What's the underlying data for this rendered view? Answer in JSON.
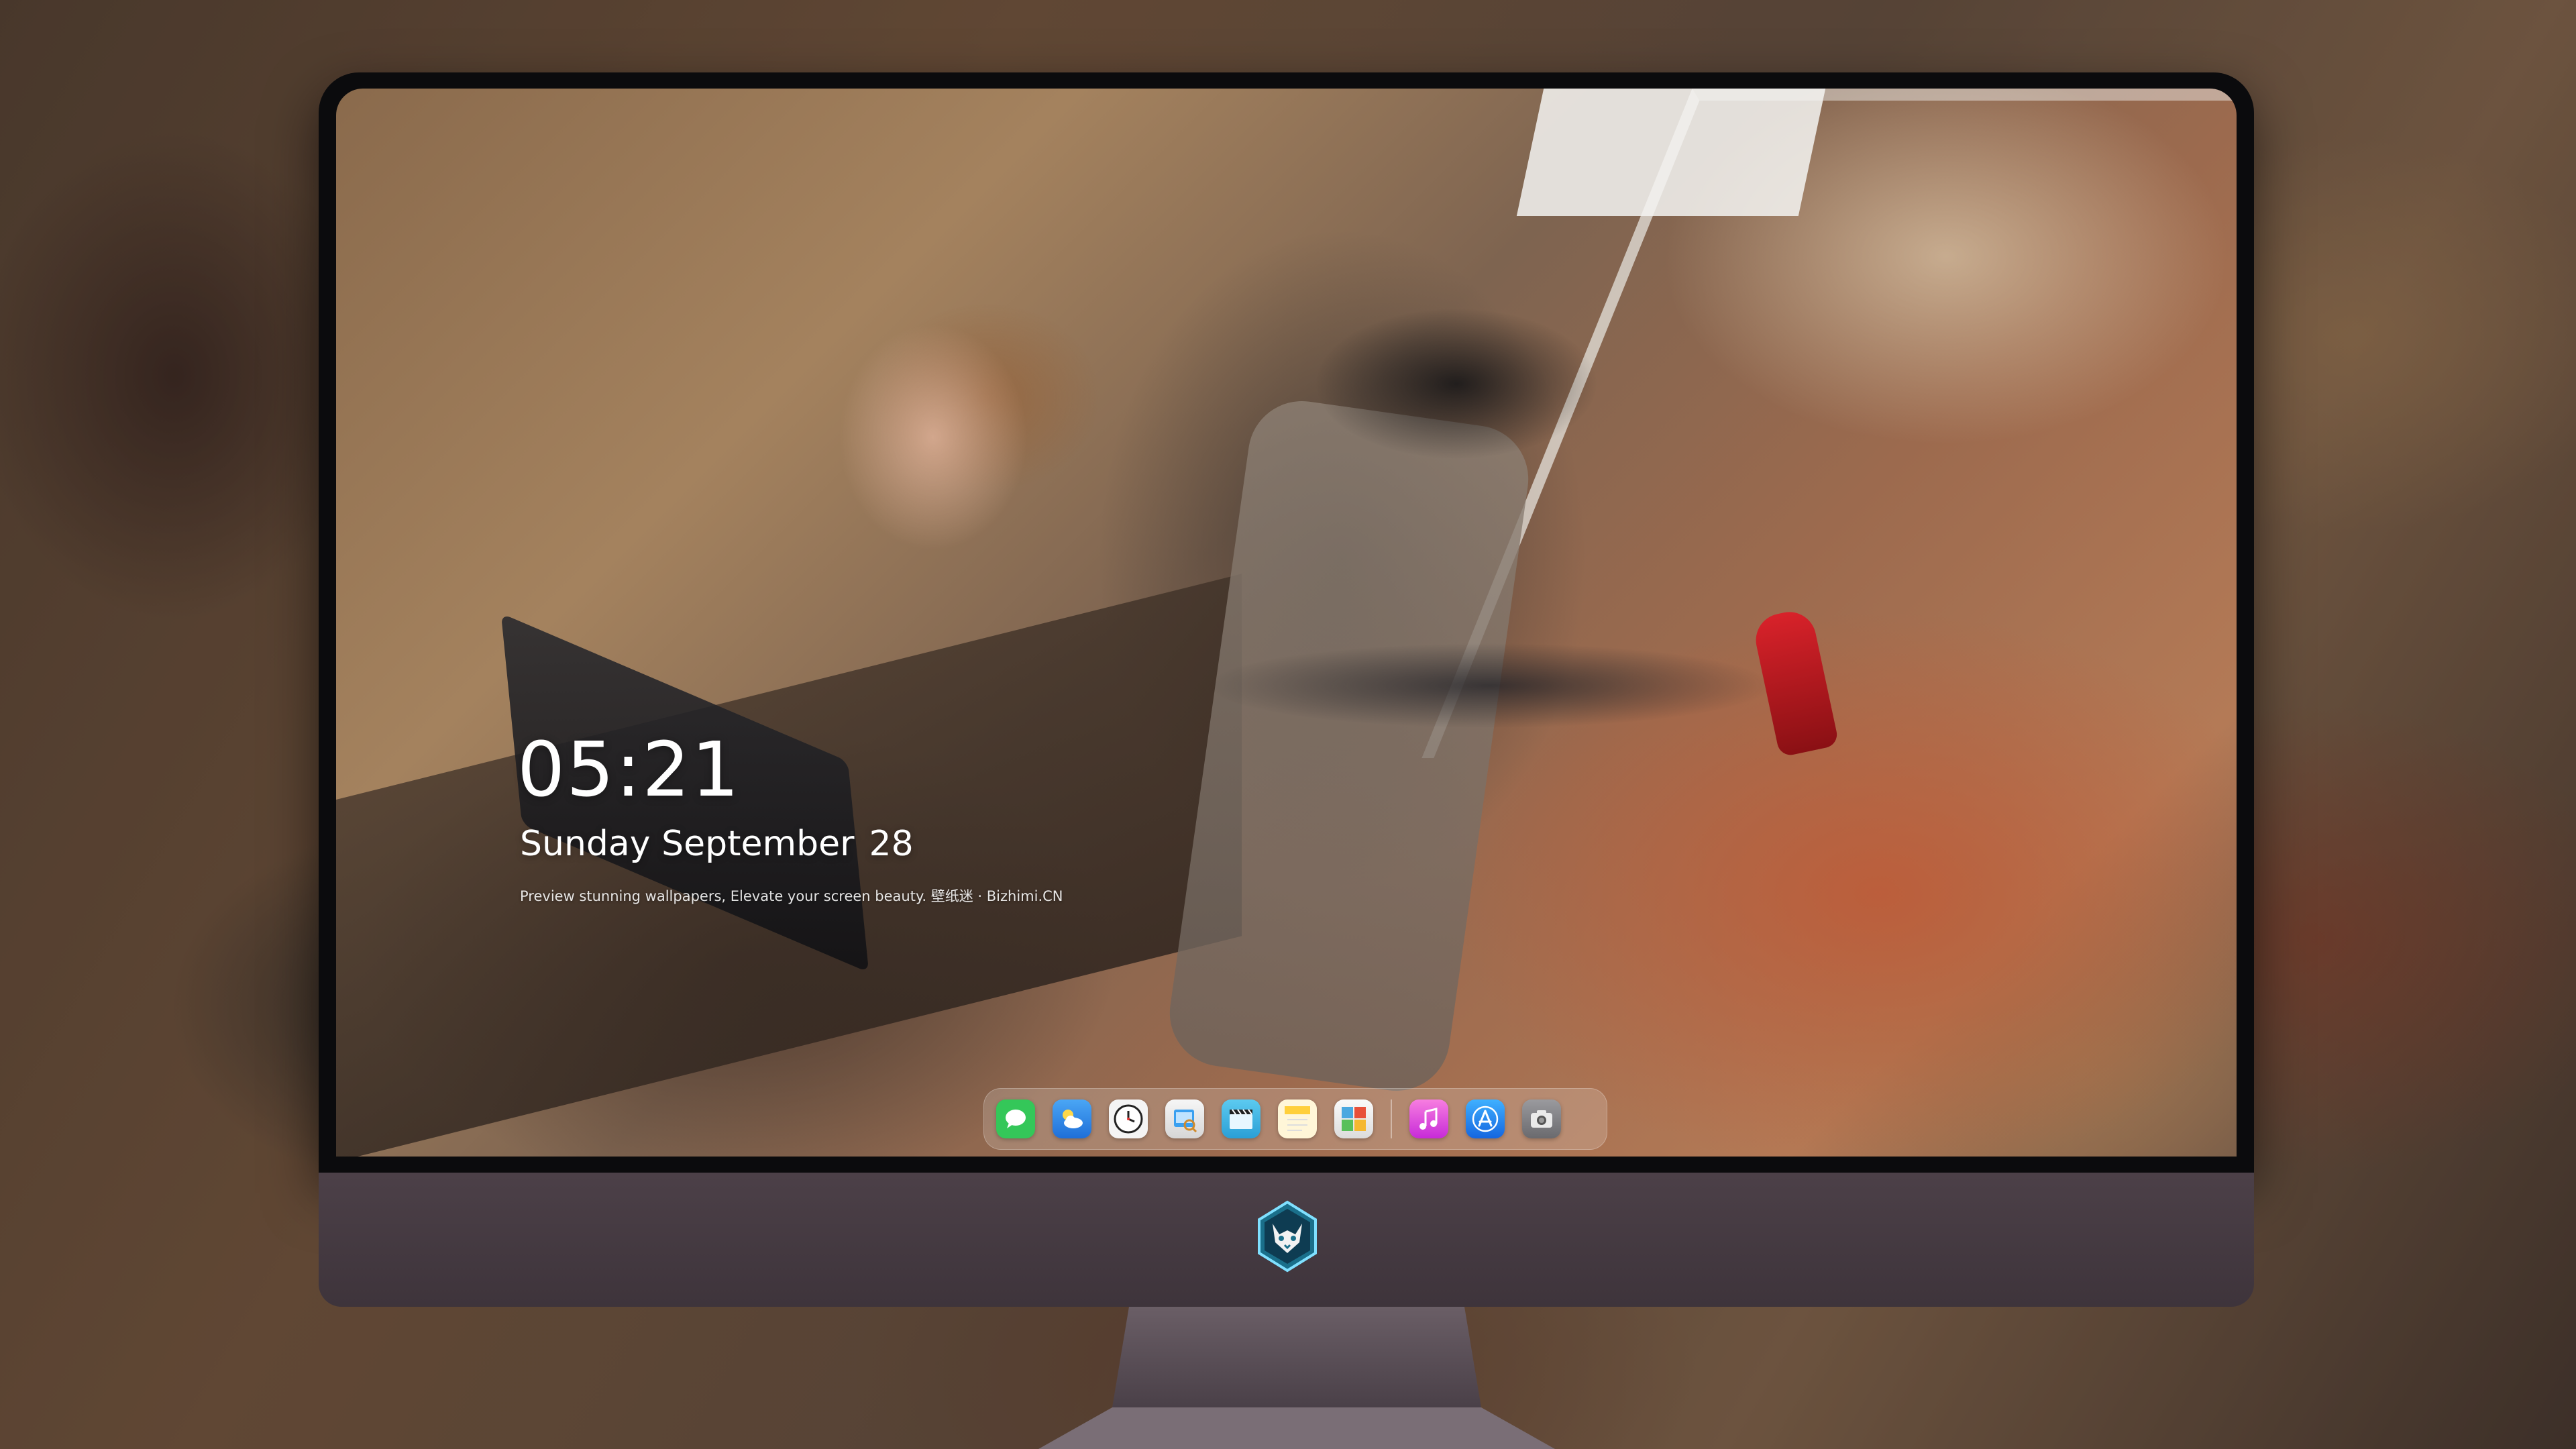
{
  "lock_screen": {
    "time": "05:21",
    "weekday_month": "Sunday September",
    "day": "28",
    "tagline": "Preview stunning wallpapers, Elevate your screen beauty. 壁纸迷 · Bizhimi.CN"
  },
  "dock": {
    "items": [
      {
        "name": "messages-icon",
        "color": "#34c759"
      },
      {
        "name": "weather-icon",
        "color": "#2f8cf0"
      },
      {
        "name": "clock-icon",
        "color": "#ffffff"
      },
      {
        "name": "preview-icon",
        "color": "#3aa0f0"
      },
      {
        "name": "video-editor-icon",
        "color": "#39b7e8"
      },
      {
        "name": "notes-icon",
        "color": "#ffd24a"
      },
      {
        "name": "photo-booth-icon",
        "color": "#4aa8e0"
      },
      {
        "name": "music-icon",
        "color": "#e93fd0"
      },
      {
        "name": "app-store-icon",
        "color": "#1e8cf5"
      },
      {
        "name": "screenshot-icon",
        "color": "#8a8a8e"
      }
    ]
  },
  "monitor": {
    "bezel_color": "#0b0b0d",
    "chin_color": "#4c4048",
    "stand_color": "#5a4f58",
    "logo": "fox-mascot-logo"
  }
}
